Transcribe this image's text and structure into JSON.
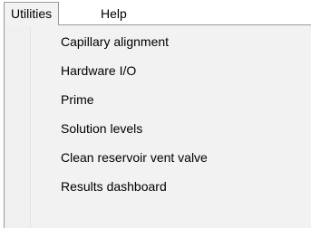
{
  "menubar": {
    "items": [
      {
        "label": "Utilities"
      },
      {
        "label": "Help"
      }
    ]
  },
  "dropdown": {
    "items": [
      {
        "label": "Capillary alignment"
      },
      {
        "label": "Hardware I/O"
      },
      {
        "label": "Prime"
      },
      {
        "label": "Solution levels"
      },
      {
        "label": "Clean reservoir vent valve"
      },
      {
        "label": "Results dashboard"
      }
    ]
  },
  "colors": {
    "menu_background": "#f2f2f2",
    "menu_border": "#999999",
    "text": "#000000"
  }
}
